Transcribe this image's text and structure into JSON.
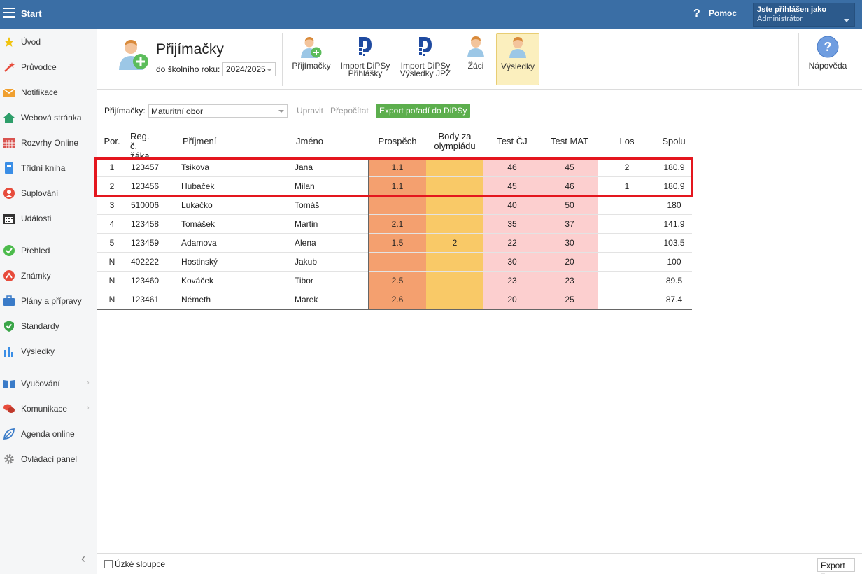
{
  "topbar": {
    "title": "Start",
    "help_label": "Pomoc",
    "help_icon": "?",
    "user_line1": "Jste přihlášen jako",
    "user_line2": "Administrátor"
  },
  "sidebar": {
    "items": [
      {
        "label": "Úvod",
        "icon": "star-icon",
        "color": "#f1c40f"
      },
      {
        "label": "Průvodce",
        "icon": "magic-wand-icon",
        "color": "#e74c3c"
      },
      {
        "label": "Notifikace",
        "icon": "envelope-icon",
        "color": "#f0a030"
      },
      {
        "label": "Webová stránka",
        "icon": "home-icon",
        "color": "#2e9e6a"
      },
      {
        "label": "Rozvrhy Online",
        "icon": "calendar-grid-icon",
        "color": "#d9534f"
      },
      {
        "label": "Třídní kniha",
        "icon": "book-icon",
        "color": "#3a8ee6"
      },
      {
        "label": "Suplování",
        "icon": "person-icon",
        "color": "#e74c3c"
      },
      {
        "label": "Události",
        "icon": "calendar-icon",
        "color": "#333333"
      },
      {
        "label": "Přehled",
        "icon": "check-circle-icon",
        "color": "#4cbb4c"
      },
      {
        "label": "Známky",
        "icon": "grade-icon",
        "color": "#e74c3c"
      },
      {
        "label": "Plány a přípravy",
        "icon": "briefcase-icon",
        "color": "#3a7bc8"
      },
      {
        "label": "Standardy",
        "icon": "shield-icon",
        "color": "#3aa548"
      },
      {
        "label": "Výsledky",
        "icon": "bar-chart-icon",
        "color": "#3a8ee6"
      },
      {
        "label": "Vyučování",
        "icon": "open-book-icon",
        "color": "#3a7bc8"
      },
      {
        "label": "Komunikace",
        "icon": "chat-icon",
        "color": "#e74c3c"
      },
      {
        "label": "Agenda online",
        "icon": "leaf-icon",
        "color": "#3a7bc8"
      },
      {
        "label": "Ovládací panel",
        "icon": "gear-icon",
        "color": "#888888"
      }
    ],
    "collapse_icon": "‹"
  },
  "header": {
    "title": "Přijímačky",
    "year_label": "do školního roku:",
    "year_value": "2024/2025",
    "toolbar": [
      {
        "label1": "Přijímačky",
        "label2": "",
        "icon": "person-add-icon"
      },
      {
        "label1": "Import DiPSy",
        "label2": "Přihlášky",
        "icon": "dipsy-logo-icon"
      },
      {
        "label1": "Import DiPSy",
        "label2": "Výsledky JPZ",
        "icon": "dipsy-logo-icon"
      },
      {
        "label1": "Žáci",
        "label2": "",
        "icon": "person-icon"
      },
      {
        "label1": "Výsledky",
        "label2": "",
        "icon": "person-icon"
      }
    ],
    "help_label": "Nápověda",
    "help_icon": "?"
  },
  "filter": {
    "label": "Přijímačky:",
    "value": "Maturitní obor",
    "edit_link": "Upravit",
    "recalc_link": "Přepočítat",
    "export_button": "Export pořadí do DiPSy"
  },
  "table": {
    "headers": {
      "por": "Por.",
      "reg1": "Reg. č.",
      "reg2": "žáka",
      "prijmeni": "Příjmení",
      "jmeno": "Jméno",
      "prospech": "Prospěch",
      "olym1": "Body za",
      "olym2": "olympiádu",
      "testcj": "Test ČJ",
      "testmat": "Test MAT",
      "los": "Los",
      "spolu": "Spolu"
    },
    "rows": [
      {
        "por": "1",
        "reg": "123457",
        "prijmeni": "Tsikova",
        "jmeno": "Jana",
        "prospech": "1.1",
        "olym": "",
        "cj": "46",
        "mat": "45",
        "los": "2",
        "spolu": "180.9"
      },
      {
        "por": "2",
        "reg": "123456",
        "prijmeni": "Hubaček",
        "jmeno": "Milan",
        "prospech": "1.1",
        "olym": "",
        "cj": "45",
        "mat": "46",
        "los": "1",
        "spolu": "180.9"
      },
      {
        "por": "3",
        "reg": "510006",
        "prijmeni": "Lukačko",
        "jmeno": "Tomáš",
        "prospech": "",
        "olym": "",
        "cj": "40",
        "mat": "50",
        "los": "",
        "spolu": "180"
      },
      {
        "por": "4",
        "reg": "123458",
        "prijmeni": "Tomášek",
        "jmeno": "Martin",
        "prospech": "2.1",
        "olym": "",
        "cj": "35",
        "mat": "37",
        "los": "",
        "spolu": "141.9"
      },
      {
        "por": "5",
        "reg": "123459",
        "prijmeni": "Adamova",
        "jmeno": "Alena",
        "prospech": "1.5",
        "olym": "2",
        "cj": "22",
        "mat": "30",
        "los": "",
        "spolu": "103.5"
      },
      {
        "por": "N",
        "reg": "402222",
        "prijmeni": "Hostinský",
        "jmeno": "Jakub",
        "prospech": "",
        "olym": "",
        "cj": "30",
        "mat": "20",
        "los": "",
        "spolu": "100"
      },
      {
        "por": "N",
        "reg": "123460",
        "prijmeni": "Kováček",
        "jmeno": "Tibor",
        "prospech": "2.5",
        "olym": "",
        "cj": "23",
        "mat": "23",
        "los": "",
        "spolu": "89.5"
      },
      {
        "por": "N",
        "reg": "123461",
        "prijmeni": "Németh",
        "jmeno": "Marek",
        "prospech": "2.6",
        "olym": "",
        "cj": "20",
        "mat": "25",
        "los": "",
        "spolu": "87.4"
      }
    ]
  },
  "footer": {
    "narrow_label": "Úzké sloupce",
    "export_label": "Export ▾"
  },
  "colors": {
    "topbar": "#3a6ea5",
    "highlight": "#e4161e",
    "prospech_bg": "#f4a06f",
    "olympiada_bg": "#f9c967",
    "test_bg": "#fccfcf",
    "export_green": "#5cae4d"
  }
}
